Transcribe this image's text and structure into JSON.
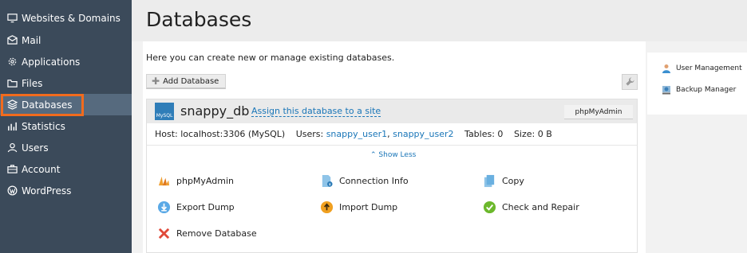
{
  "sidebar": {
    "items": [
      {
        "label": "Websites & Domains",
        "icon": "monitor-icon"
      },
      {
        "label": "Mail",
        "icon": "mail-icon"
      },
      {
        "label": "Applications",
        "icon": "gear-icon"
      },
      {
        "label": "Files",
        "icon": "folder-icon"
      },
      {
        "label": "Databases",
        "icon": "layers-icon"
      },
      {
        "label": "Statistics",
        "icon": "bar-chart-icon"
      },
      {
        "label": "Users",
        "icon": "user-icon"
      },
      {
        "label": "Account",
        "icon": "briefcase-icon"
      },
      {
        "label": "WordPress",
        "icon": "wordpress-icon"
      }
    ],
    "active": "Databases",
    "collapse_glyph": "‹"
  },
  "page": {
    "title": "Databases",
    "intro": "Here you can create new or manage existing databases."
  },
  "toolbar": {
    "add_database_label": "Add Database"
  },
  "database": {
    "name": "snappy_db",
    "logo_text": "MySQL",
    "assign_link": "Assign this database to a site",
    "phpmyadmin_button": "phpMyAdmin",
    "host_label": "Host: localhost:3306 (MySQL)",
    "users_label": "Users:",
    "user1": "snappy_user1",
    "separator": ",",
    "user2": "snappy_user2",
    "tables_label": "Tables: 0",
    "size_label": "Size: 0 B",
    "show_less": "⌃ Show Less",
    "actions": [
      {
        "label": "phpMyAdmin",
        "icon": "phpmyadmin-icon"
      },
      {
        "label": "Connection Info",
        "icon": "connection-info-icon"
      },
      {
        "label": "Copy",
        "icon": "copy-icon"
      },
      {
        "label": "Export Dump",
        "icon": "export-icon"
      },
      {
        "label": "Import Dump",
        "icon": "import-icon"
      },
      {
        "label": "Check and Repair",
        "icon": "check-icon"
      },
      {
        "label": "Remove Database",
        "icon": "remove-icon"
      }
    ]
  },
  "right_panel": {
    "items": [
      {
        "label": "User Management",
        "icon": "user-management-icon"
      },
      {
        "label": "Backup Manager",
        "icon": "backup-manager-icon"
      }
    ]
  },
  "colors": {
    "sidebar_bg": "#3b4a5a",
    "sidebar_active_bg": "#566a7e",
    "active_outline": "#f26b1d",
    "link": "#1a76b8"
  }
}
